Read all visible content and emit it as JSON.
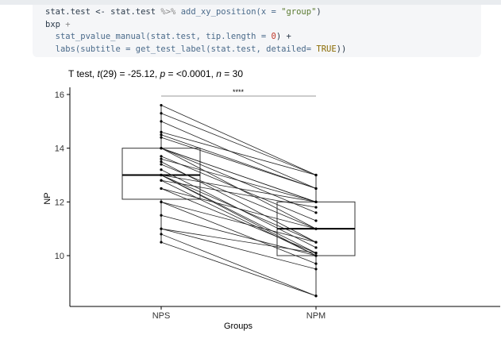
{
  "code": {
    "line1": [
      "stat.test <- stat.test ",
      "%>%",
      " add_xy_position(x = ",
      "\"group\"",
      ")"
    ],
    "line2": [
      "bxp ",
      "+"
    ],
    "line3": [
      "  stat_pvalue_manual(stat.test, tip.length = ",
      "0",
      ") +"
    ],
    "line4": [
      "  labs(subtitle = get_test_label(stat.test, detailed= ",
      "TRUE",
      "))"
    ]
  },
  "chart_data": {
    "type": "boxplot-paired",
    "subtitle_parts": [
      "T test, ",
      "t",
      "(29) = -25.12, ",
      "p",
      " = <0.0001, ",
      "n",
      " = 30"
    ],
    "xlabel": "Groups",
    "ylabel": "NP",
    "categories": [
      "NPS",
      "NPM"
    ],
    "ylim": [
      8.2,
      16.2
    ],
    "yticks": [
      "10",
      "12",
      "14",
      "16"
    ],
    "significance": "****",
    "boxes": [
      {
        "group": "NPS",
        "min": 10.5,
        "q1": 12.1,
        "median": 13.0,
        "q3": 14.0,
        "max": 15.6
      },
      {
        "group": "NPM",
        "min": 8.5,
        "q1": 10.0,
        "median": 11.0,
        "q3": 12.0,
        "max": 13.0
      }
    ],
    "pairs": [
      [
        15.6,
        13.0
      ],
      [
        15.3,
        13.0
      ],
      [
        15.0,
        12.5
      ],
      [
        14.6,
        13.0
      ],
      [
        14.5,
        12.5
      ],
      [
        14.4,
        12.5
      ],
      [
        14.0,
        12.0
      ],
      [
        14.0,
        12.0
      ],
      [
        14.0,
        11.0
      ],
      [
        14.0,
        11.6
      ],
      [
        13.7,
        11.3
      ],
      [
        13.6,
        12.0
      ],
      [
        13.5,
        10.5
      ],
      [
        13.4,
        11.0
      ],
      [
        13.2,
        10.3
      ],
      [
        13.0,
        12.0
      ],
      [
        13.0,
        10.5
      ],
      [
        13.0,
        10.0
      ],
      [
        13.0,
        10.1
      ],
      [
        12.8,
        10.0
      ],
      [
        12.5,
        11.0
      ],
      [
        12.5,
        10.1
      ],
      [
        12.0,
        9.7
      ],
      [
        12.0,
        10.5
      ],
      [
        11.5,
        10.0
      ],
      [
        11.0,
        9.5
      ],
      [
        11.0,
        10.1
      ],
      [
        10.8,
        8.5
      ],
      [
        10.5,
        8.5
      ],
      [
        12.8,
        11.8
      ]
    ]
  }
}
